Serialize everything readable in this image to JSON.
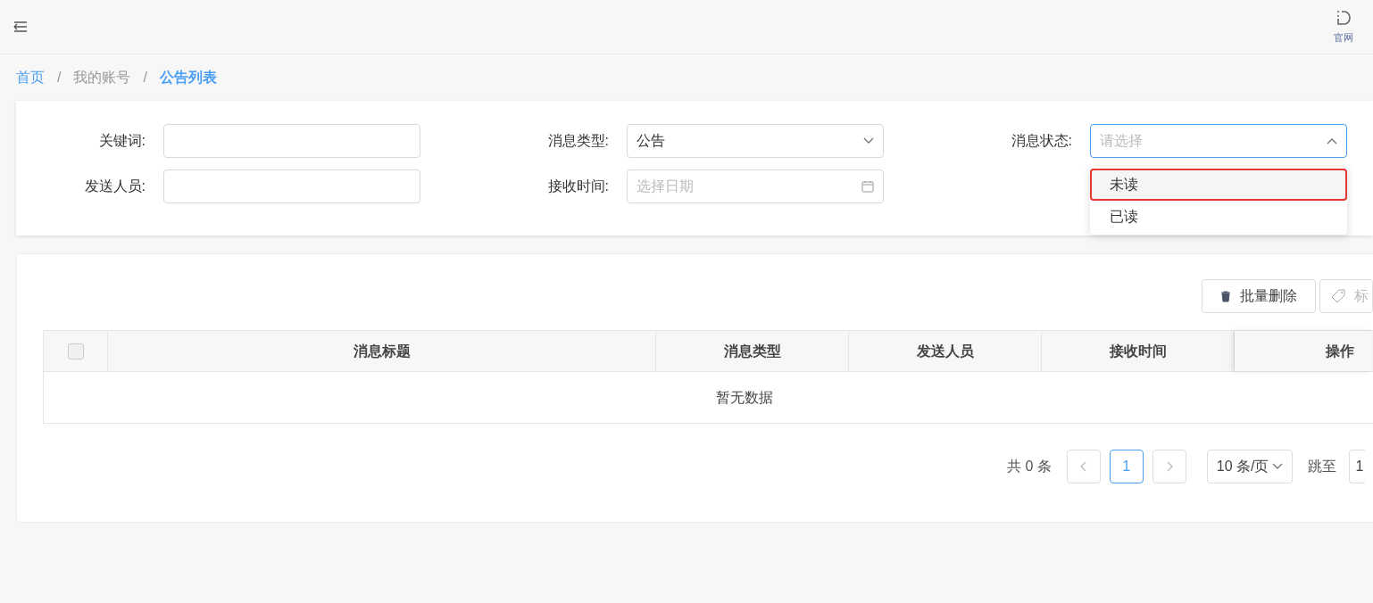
{
  "header": {
    "links": [
      {
        "label": "官网"
      }
    ]
  },
  "breadcrumb": [
    {
      "label": "首页",
      "current": false
    },
    {
      "separator": "/",
      "label": "我的账号",
      "current": false
    },
    {
      "separator": "/",
      "label": "公告列表",
      "current": true
    }
  ],
  "filters": [
    {
      "label": "关键词:",
      "kind": "text"
    },
    {
      "label": "消息类型:",
      "kind": "select",
      "value": "公告",
      "open": false
    },
    {
      "label": "消息状态:",
      "kind": "select",
      "placeholder": "请选择",
      "open": true
    },
    {
      "label": "发送人员:",
      "kind": "text"
    },
    {
      "label": "接收时间:",
      "kind": "date",
      "placeholder": "选择日期"
    }
  ],
  "dropdown_options": [
    {
      "label": "未读",
      "highlighted": true
    },
    {
      "label": "已读",
      "highlighted": false
    }
  ],
  "toolbar": [
    {
      "label": "批量删除",
      "kind": "delete",
      "disabled": false
    },
    {
      "label": "标",
      "kind": "tag",
      "disabled": true
    }
  ],
  "table": {
    "columns": [
      "消息标题",
      "消息类型",
      "发送人员",
      "接收时间",
      "操作"
    ],
    "select_all": {
      "checked": false
    },
    "empty_text": "暂无数据"
  },
  "pagination": {
    "total": "共 0 条",
    "pages": [
      {
        "label": "1",
        "selected": true
      }
    ],
    "page_size": "10 条/页",
    "jump_label": "跳至",
    "jump_value": "1"
  }
}
